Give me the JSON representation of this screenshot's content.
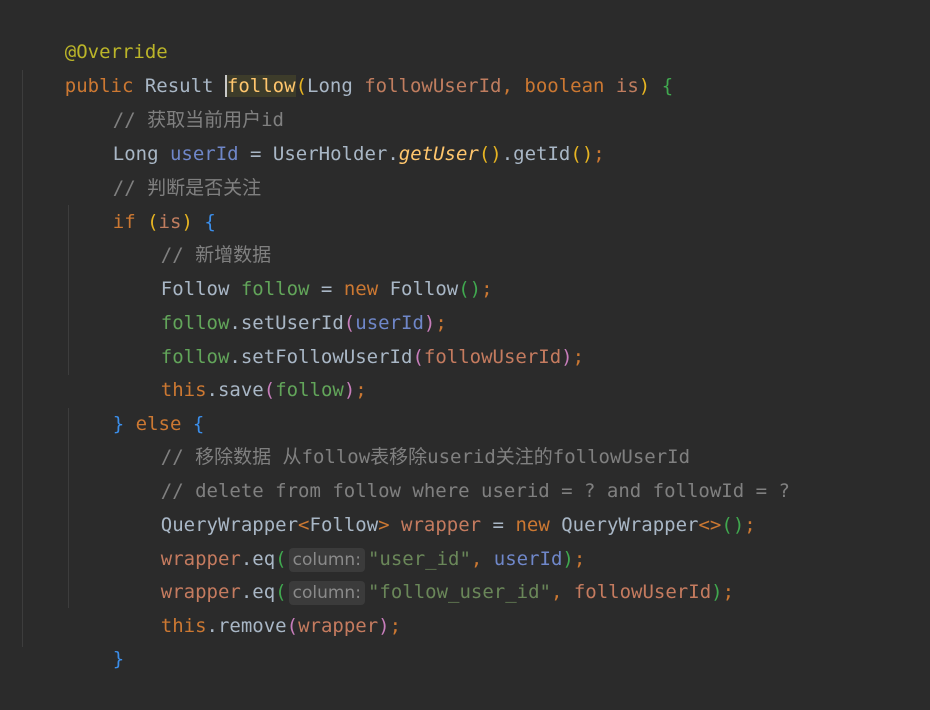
{
  "code": {
    "l1": {
      "anno": "@Override"
    },
    "l2": {
      "kw_public": "public",
      "type_result": " Result ",
      "method": "follow",
      "open": "(",
      "type_long": "Long ",
      "param1": "followUserId",
      "comma": ", ",
      "kw_boolean": "boolean ",
      "param2": "is",
      "close": ")",
      "brace": " {"
    },
    "l3": {
      "comment": "// 获取当前用户id"
    },
    "l4": {
      "type": "Long ",
      "var": "userId",
      "eq": " = UserHolder.",
      "call": "getUser",
      "parens": "()",
      "tail": ".getId",
      "parens2": "()",
      "semi": ";"
    },
    "l5": {
      "comment": "// 判断是否关注"
    },
    "l6": {
      "kw": "if ",
      "open": "(",
      "var": "is",
      "close": ")",
      "brace": " {"
    },
    "l7": {
      "comment": "// 新增数据"
    },
    "l8": {
      "type": "Follow ",
      "var": "follow",
      "eq": " = ",
      "kw_new": "new ",
      "ctor": "Follow",
      "parens": "()",
      "semi": ";"
    },
    "l9": {
      "obj": "follow",
      "method": ".setUserId",
      "open": "(",
      "arg": "userId",
      "close": ")",
      "semi": ";"
    },
    "l10": {
      "obj": "follow",
      "method": ".setFollowUserId",
      "open": "(",
      "arg": "followUserId",
      "close": ")",
      "semi": ";"
    },
    "l11": {
      "kw": "this",
      "method": ".save",
      "open": "(",
      "arg": "follow",
      "close": ")",
      "semi": ";"
    },
    "l12": {
      "close": "}",
      "kw": " else ",
      "brace": "{"
    },
    "l13": {
      "comment": "// 移除数据 从follow表移除userid关注的followUserId"
    },
    "l14": {
      "comment": "// delete from follow where userid = ? and followId = ?"
    },
    "l15": {
      "type": "QueryWrapper",
      "lt": "<",
      "generic": "Follow",
      "gt": ">",
      "var": " wrapper",
      "eq": " = ",
      "kw_new": "new ",
      "ctor": "QueryWrapper",
      "diamond": "<>",
      "parens": "()",
      "semi": ";"
    },
    "l16": {
      "obj": "wrapper",
      "method": ".eq",
      "open": "(",
      "hint": "column:",
      "str": "\"user_id\"",
      "comma": ", ",
      "arg": "userId",
      "close": ")",
      "semi": ";"
    },
    "l17": {
      "obj": "wrapper",
      "method": ".eq",
      "open": "(",
      "hint": "column:",
      "str": "\"follow_user_id\"",
      "comma": ", ",
      "arg": "followUserId",
      "close": ")",
      "semi": ";"
    },
    "l18": {
      "kw": "this",
      "method": ".remove",
      "open": "(",
      "arg": "wrapper",
      "close": ")",
      "semi": ";"
    },
    "l19": {
      "close": "}"
    }
  }
}
